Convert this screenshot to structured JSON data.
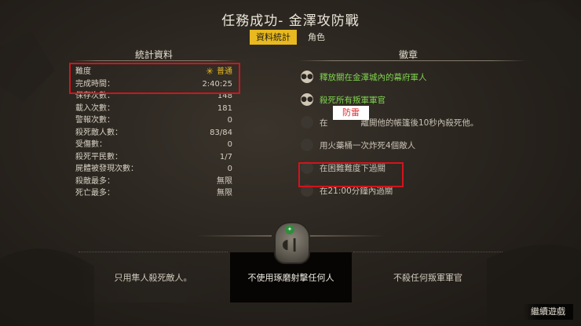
{
  "screen": {
    "title": "任務成功- 金澤攻防戰",
    "tabs": [
      {
        "label": "資料統計",
        "active": true
      },
      {
        "label": "角色",
        "active": false
      }
    ]
  },
  "stats_panel": {
    "heading": "統計資料",
    "rows": [
      {
        "label": "難度",
        "value": "普通",
        "icon": "sun-icon"
      },
      {
        "label": "完成時間：",
        "value": "2:40:25"
      },
      {
        "label": "保存次數：",
        "value": "148"
      },
      {
        "label": "載入次數：",
        "value": "181"
      },
      {
        "label": "警報次數：",
        "value": "0"
      },
      {
        "label": "殺死敵人數：",
        "value": "83/84"
      },
      {
        "label": "受傷數：",
        "value": "0"
      },
      {
        "label": "殺死平民數：",
        "value": "1/7"
      },
      {
        "label": "屍體被發現次數：",
        "value": "0"
      },
      {
        "label": "殺敵最多：",
        "value": "無限"
      },
      {
        "label": "死亡最多：",
        "value": "無限"
      }
    ]
  },
  "medals_panel": {
    "heading": "徽章",
    "items": [
      {
        "text": "釋放關在金澤城內的幕府軍人",
        "completed": true
      },
      {
        "text": "殺死所有叛軍軍官",
        "completed": true
      },
      {
        "text": "在　　　　離開他的帳篷後10秒內殺死他。",
        "completed": false
      },
      {
        "text": "用火藥桶一次炸死4個敵人",
        "completed": false
      },
      {
        "text": "在困難難度下過關",
        "completed": false
      },
      {
        "text": "在21:00分鐘內過關",
        "completed": false
      }
    ],
    "overlay_label": "防雷"
  },
  "challenges": {
    "left": "只用隼人殺死敵人。",
    "middle": "不使用琢磨射擊任何人",
    "right": "不殺任何叛軍軍官"
  },
  "footer": {
    "continue_label": "繼續遊戲"
  },
  "colors": {
    "accent": "#e8b920",
    "completed": "#7fd34f",
    "highlight_box": "#d2141c"
  }
}
